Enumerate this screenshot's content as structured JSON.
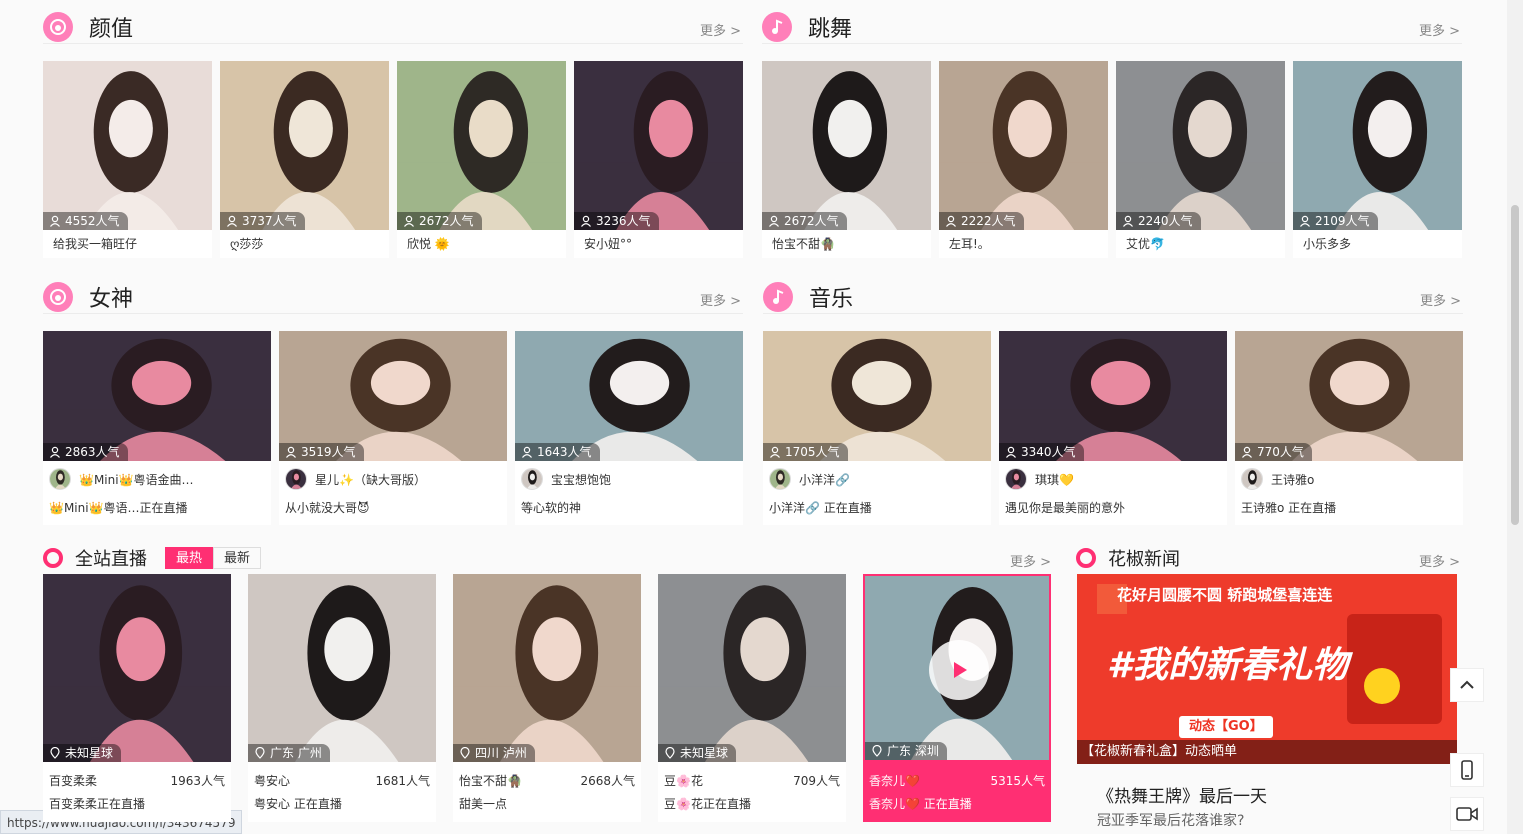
{
  "sections": {
    "yanzhi": {
      "title": "颜值",
      "more": "更多 >",
      "icon": "face-icon",
      "items": [
        {
          "pop": "4552人气",
          "name": "给我买一箱旺仔"
        },
        {
          "pop": "3737人气",
          "name": "ღ莎莎"
        },
        {
          "pop": "2672人气",
          "name": "欣悦 🌞"
        },
        {
          "pop": "3236人气",
          "name": "安小妞°°"
        }
      ]
    },
    "tiaowu": {
      "title": "跳舞",
      "more": "更多 >",
      "icon": "dance-icon",
      "items": [
        {
          "pop": "2672人气",
          "name": "怡宝不甜🧌"
        },
        {
          "pop": "2222人气",
          "name": "左耳!。"
        },
        {
          "pop": "2240人气",
          "name": "艾优🐬"
        },
        {
          "pop": "2109人气",
          "name": "小乐多多"
        }
      ]
    },
    "nvshen": {
      "title": "女神",
      "more": "更多 >",
      "icon": "goddess-icon",
      "items": [
        {
          "pop": "2863人气",
          "user": "👑Mini👑粤语金曲…",
          "desc": "👑Mini👑粤语…正在直播"
        },
        {
          "pop": "3519人气",
          "user": "星儿✨（缺大哥版）",
          "desc": "从小就没大哥😈"
        },
        {
          "pop": "1643人气",
          "user": "宝宝想饱饱",
          "desc": "等心软的神"
        }
      ]
    },
    "yinyue": {
      "title": "音乐",
      "more": "更多 >",
      "icon": "music-icon",
      "items": [
        {
          "pop": "1705人气",
          "user": "小洋洋🔗",
          "desc": "小洋洋🔗 正在直播"
        },
        {
          "pop": "3340人气",
          "user": "琪琪💛",
          "desc": "遇见你是最美丽的意外"
        },
        {
          "pop": "770人气",
          "user": "王诗雅o",
          "desc": "王诗雅o 正在直播"
        }
      ]
    }
  },
  "live": {
    "title": "全站直播",
    "more": "更多 >",
    "tabs": [
      "最热",
      "最新"
    ],
    "items": [
      {
        "loc": "未知星球",
        "name": "百变柔柔",
        "pop": "1963人气",
        "desc": "百变柔柔正在直播"
      },
      {
        "loc": "广东 广州",
        "name": "粤安心",
        "pop": "1681人气",
        "desc": "粤安心 正在直播"
      },
      {
        "loc": "四川 泸州",
        "name": "怡宝不甜🧌",
        "pop": "2668人气",
        "desc": "甜美一点"
      },
      {
        "loc": "未知星球",
        "name": "豆🌸花",
        "pop": "709人气",
        "desc": "豆🌸花正在直播"
      },
      {
        "loc": "广东 深圳",
        "name": "香奈儿❤️",
        "pop": "5315人气",
        "desc": "香奈儿❤️ 正在直播"
      }
    ]
  },
  "news": {
    "title": "花椒新闻",
    "more": "更多 >",
    "banner_top": "花好月圆腰不圆 轿跑城堡喜连连",
    "banner_big": "#我的新春礼物",
    "banner_btn": "动态【GO】",
    "banner_caption": "【花椒新春礼盒】动态晒单",
    "headline": "《热舞王牌》最后一天",
    "subline": "冠亚季军最后花落谁家?"
  },
  "status_url": "https://www.huajiao.com/l/343674579",
  "colors": {
    "accent": "#ff2f73",
    "section_icon": "#ff7fb9"
  }
}
